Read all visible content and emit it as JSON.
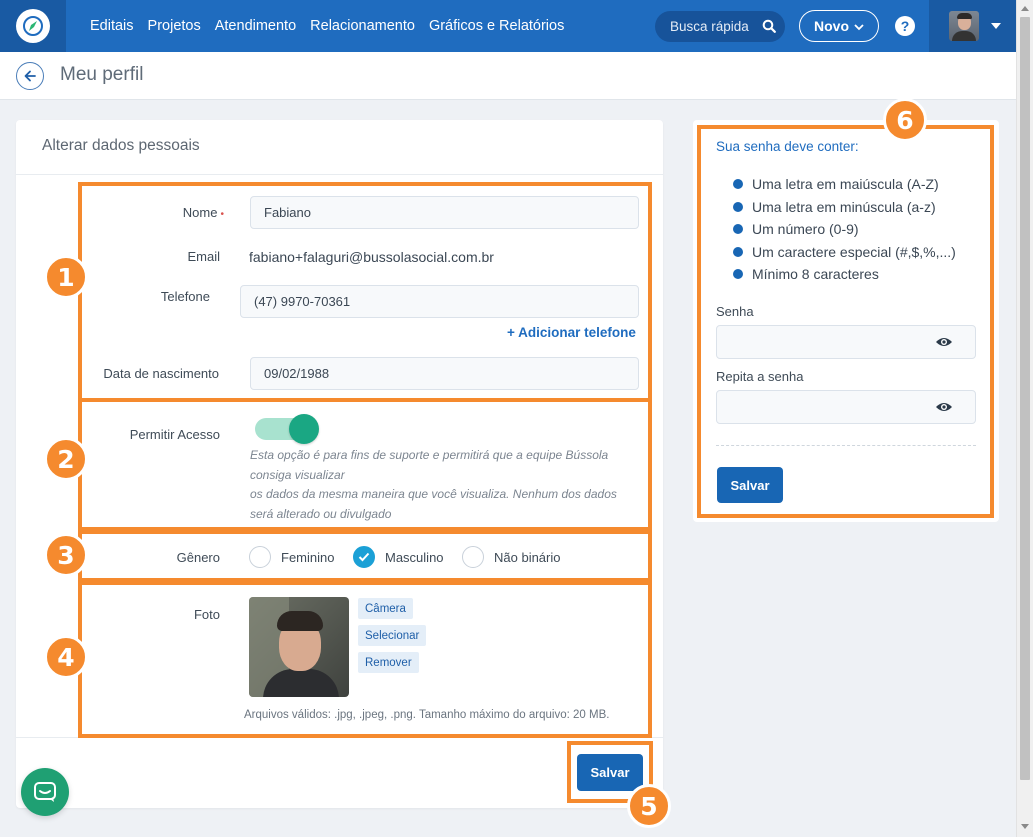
{
  "nav": {
    "items": [
      "Editais",
      "Projetos",
      "Atendimento",
      "Relacionamento",
      "Gráficos e Relatórios"
    ],
    "search_placeholder": "Busca rápida",
    "new_button": "Novo",
    "help": "?"
  },
  "page": {
    "title": "Meu perfil"
  },
  "personal": {
    "title": "Alterar dados pessoais",
    "name_label": "Nome",
    "name_value": "Fabiano",
    "email_label": "Email",
    "email_value": "fabiano+falaguri@bussolasocial.com.br",
    "phone_label": "Telefone",
    "phone_value": "(47) 9970-70361",
    "add_phone": "Adicionar telefone",
    "birth_label": "Data de nascimento",
    "birth_value": "09/02/1988",
    "access_label": "Permitir Acesso",
    "access_enabled": true,
    "access_hint": [
      "Esta opção é para fins de suporte e permitirá que a equipe Bússola",
      "consiga visualizar",
      "os dados da mesma maneira que você visualiza. Nenhum dos dados",
      "será alterado ou divulgado"
    ],
    "gender_label": "Gênero",
    "gender_options": [
      "Feminino",
      "Masculino",
      "Não binário"
    ],
    "gender_selected": "Masculino",
    "photo_label": "Foto",
    "photo_buttons": [
      "Câmera",
      "Selecionar",
      "Remover"
    ],
    "file_hint": "Arquivos válidos: .jpg, .jpeg, .png. Tamanho máximo do arquivo: 20 MB.",
    "save": "Salvar"
  },
  "password": {
    "title": "Sua senha deve conter:",
    "rules": [
      "Uma letra em maiúscula (A-Z)",
      "Uma letra em minúscula (a-z)",
      "Um número (0-9)",
      "Um caractere especial (#,$,%,...)",
      "Mínimo 8 caracteres"
    ],
    "password_label": "Senha",
    "repeat_label": "Repita a senha",
    "save": "Salvar"
  },
  "annotations": [
    "1",
    "2",
    "3",
    "4",
    "5",
    "6"
  ],
  "colors": {
    "nav": "#1f6cbf",
    "accent": "#f58a2e",
    "primary_button": "#1866b4",
    "toggle": "#1aa783"
  }
}
